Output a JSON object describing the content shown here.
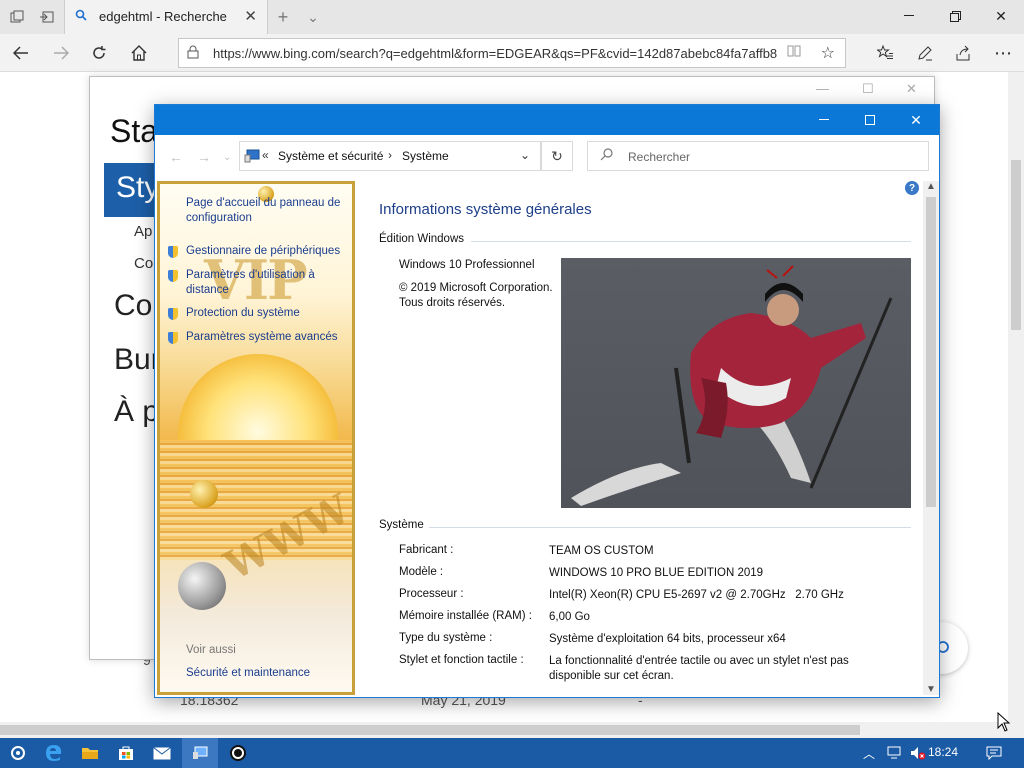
{
  "browser": {
    "tab_title": "edgehtml - Recherche",
    "url": "https://www.bing.com/search?q=edgehtml&form=EDGEAR&qs=PF&cvid=142d87abebc84fa7affb8",
    "new_tab_glyph": "+",
    "tab_list_glyph": "⌄"
  },
  "settings_window": {
    "heading": "Sta",
    "selected": "Sty",
    "items": [
      "Ap",
      "Co"
    ],
    "big_items": [
      "Con",
      "Bur",
      "À p"
    ]
  },
  "background_page": {
    "row_version": "18.18362",
    "row_date": "May 21, 2019",
    "row_dash": "-",
    "left_fragment": "9"
  },
  "system_window": {
    "breadcrumb_root": "«",
    "breadcrumb": [
      "Système et sécurité",
      "Système"
    ],
    "search_placeholder": "Rechercher",
    "left_pane": {
      "links": [
        "Page d'accueil du panneau de configuration",
        "Gestionnaire de périphériques",
        "Paramètres d'utilisation à distance",
        "Protection du système",
        "Paramètres système avancés"
      ],
      "see_also": "Voir aussi",
      "security_link": "Sécurité et maintenance",
      "skin_text_vip": "VIP",
      "skin_text_www": "WWW"
    },
    "main": {
      "title": "Informations système générales",
      "edition_header": "Édition Windows",
      "edition_name": "Windows 10 Professionnel",
      "copyright_1": "© 2019 Microsoft Corporation.",
      "copyright_2": "Tous droits réservés.",
      "system_header": "Système",
      "system_rows": [
        {
          "k": "Fabricant :",
          "v": "TEAM OS CUSTOM"
        },
        {
          "k": "Modèle :",
          "v": "WINDOWS 10 PRO BLUE EDITION 2019"
        },
        {
          "k": "Processeur :",
          "v": "Intel(R) Xeon(R) CPU E5-2697 v2 @ 2.70GHz   2.70 GHz"
        },
        {
          "k": "Mémoire installée (RAM) :",
          "v": "6,00 Go"
        },
        {
          "k": "Type du système :",
          "v": "Système d'exploitation 64 bits, processeur x64"
        },
        {
          "k": "Stylet et fonction tactile :",
          "v": "La fonctionnalité d'entrée tactile ou avec un stylet n'est pas disponible sur cet écran."
        }
      ]
    }
  },
  "taskbar": {
    "clock": "18:24"
  },
  "colors": {
    "titlebar": "#0b78d7",
    "taskbar": "#1b5ba5",
    "link": "#1a3d8f",
    "heading": "#1e3f8a"
  }
}
